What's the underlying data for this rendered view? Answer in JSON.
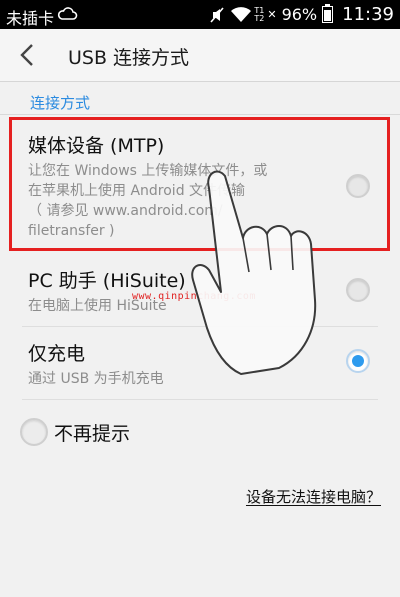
{
  "statusbar": {
    "carrier": "未插卡",
    "sim_top": "T1",
    "sim_bottom": "T2",
    "battery": "96%",
    "time": "11:39"
  },
  "header": {
    "title": "USB 连接方式"
  },
  "section": {
    "label": "连接方式"
  },
  "options": [
    {
      "title": "媒体设备 (MTP)",
      "desc_lines": [
        "让您在 Windows 上传输媒体文件，或",
        "在苹果机上使用 Android 文件传输",
        "（ 请参见 www.android.com/",
        "filetransfer )"
      ],
      "selected": false
    },
    {
      "title": "PC 助手 (HiSuite)",
      "desc": "在电脑上使用 HiSuite",
      "selected": false
    },
    {
      "title": "仅充电",
      "desc": "通过 USB 为手机充电",
      "selected": true
    }
  ],
  "dont_remind": {
    "label": "不再提示",
    "checked": false
  },
  "help_link": "设备无法连接电脑？",
  "watermark": "www.qinpinchang.com",
  "colors": {
    "accent": "#2e9bee",
    "section_label": "#2c8be0",
    "highlight": "#e52020"
  }
}
